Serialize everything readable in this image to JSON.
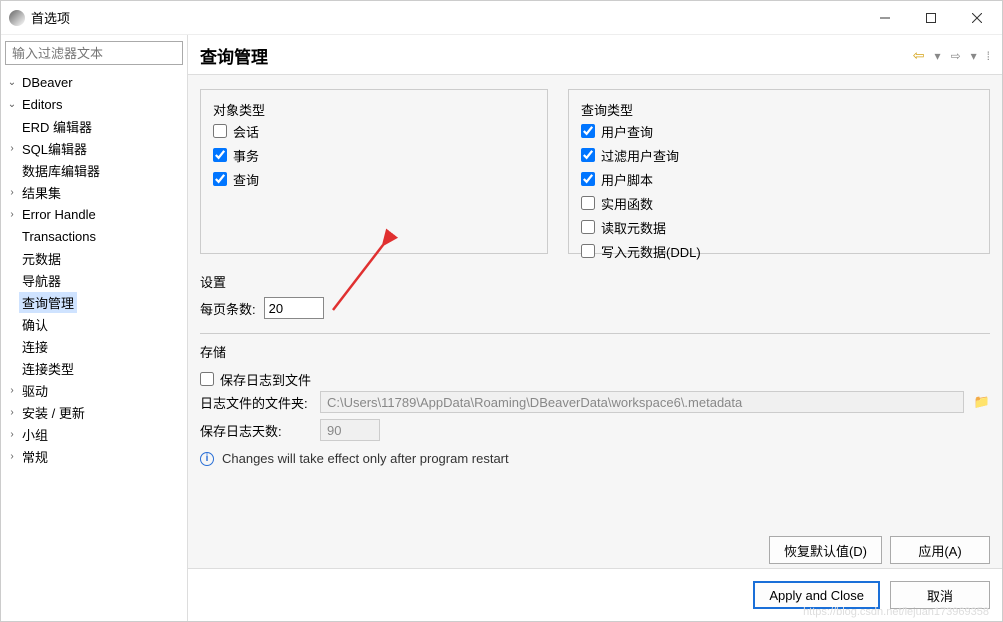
{
  "window": {
    "title": "首选项",
    "minimize": "—",
    "maximize": "□",
    "close": "✕"
  },
  "sidebar": {
    "filter_placeholder": "输入过滤器文本",
    "items": {
      "dbeaver": "DBeaver",
      "editors": "Editors",
      "erd": "ERD 编辑器",
      "sql": "SQL编辑器",
      "dbeditor": "数据库编辑器",
      "resultset": "结果集",
      "error_handle": "Error Handle",
      "transactions": "Transactions",
      "metadata": "元数据",
      "navigator": "导航器",
      "query_mgr": "查询管理",
      "confirm": "确认",
      "connection": "连接",
      "conn_type": "连接类型",
      "driver": "驱动",
      "install_update": "安装 / 更新",
      "team": "小组",
      "general": "常规"
    }
  },
  "main": {
    "title": "查询管理",
    "object_types": {
      "legend": "对象类型",
      "session": "会话",
      "transaction": "事务",
      "query": "查询"
    },
    "query_types": {
      "legend": "查询类型",
      "user_query": "用户查询",
      "filter_user": "过滤用户查询",
      "user_script": "用户脚本",
      "util_func": "实用函数",
      "read_meta": "读取元数据",
      "write_meta": "写入元数据(DDL)"
    },
    "settings": {
      "legend": "设置",
      "per_page_label": "每页条数:",
      "per_page_value": "20"
    },
    "storage": {
      "legend": "存储",
      "save_log_label": "保存日志到文件",
      "folder_label": "日志文件的文件夹:",
      "folder_value": "C:\\Users\\11789\\AppData\\Roaming\\DBeaverData\\workspace6\\.metadata",
      "days_label": "保存日志天数:",
      "days_value": "90"
    },
    "info_text": "Changes will take effect only after program restart",
    "buttons": {
      "restore": "恢复默认值(D)",
      "apply": "应用(A)",
      "apply_close": "Apply and Close",
      "cancel": "取消"
    }
  },
  "watermark": "https://blog.csdn.net/lejuan173969358"
}
